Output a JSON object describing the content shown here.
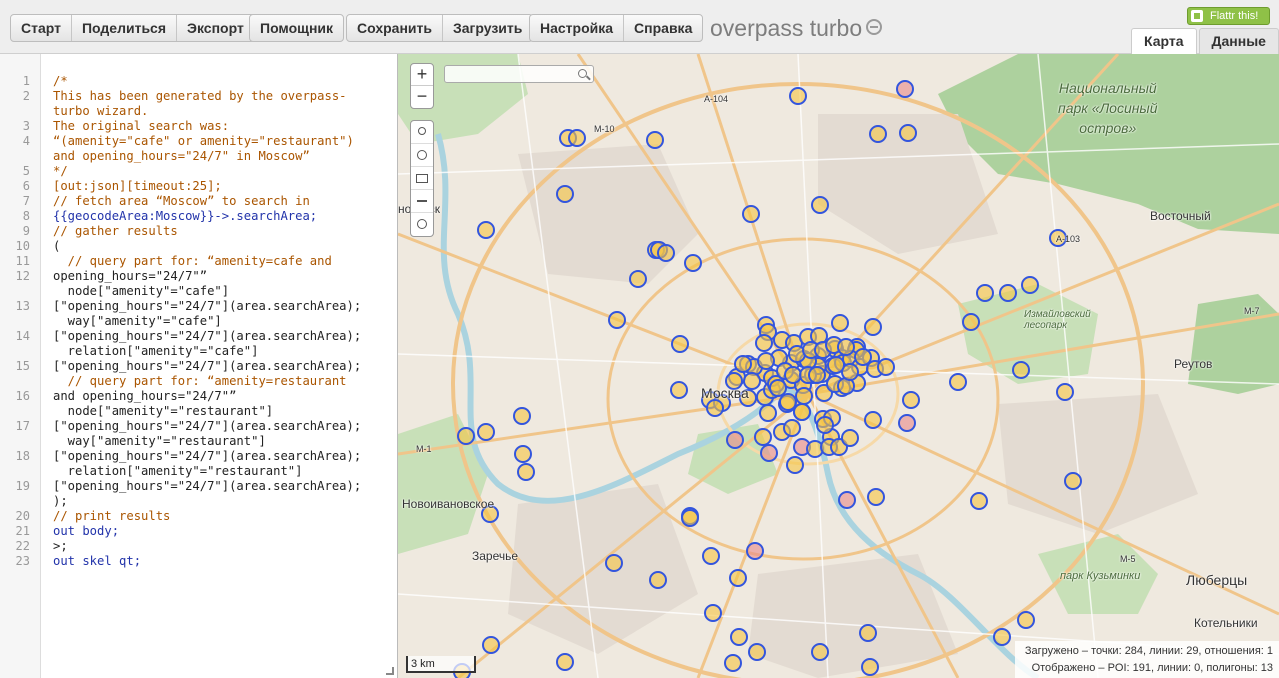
{
  "toolbar": {
    "group1": [
      "Старт",
      "Поделиться",
      "Экспорт"
    ],
    "group2": [
      "Помощник"
    ],
    "group3": [
      "Сохранить",
      "Загрузить"
    ],
    "group4": [
      "Настройка",
      "Справка"
    ],
    "app_title": "overpass turbo",
    "flattr_label": "Flattr this!"
  },
  "tabs": [
    {
      "label": "Карта",
      "active": true
    },
    {
      "label": "Данные",
      "active": false
    }
  ],
  "editor": {
    "line_numbers": [
      "1",
      "2",
      "3",
      "4",
      "5",
      "6",
      "7",
      "8",
      "9",
      "10",
      "11",
      "12",
      "13",
      "14",
      "15",
      "16",
      "17",
      "18",
      "19",
      "20",
      "21",
      "22",
      "23"
    ],
    "lines": [
      "/*",
      "This has been generated by the overpass-",
      "turbo wizard.",
      "The original search was:",
      "“(amenity=\"cafe\" or amenity=\"restaurant\")",
      "and opening_hours=\"24/7\" in Moscow”",
      "*/",
      "[out:json][timeout:25];",
      "// fetch area “Moscow” to search in",
      "{{geocodeArea:Moscow}}->.searchArea;",
      "// gather results",
      "(",
      "  // query part for: “amenity=cafe and",
      "opening_hours=\"24/7\"”",
      "  node[\"amenity\"=\"cafe\"]",
      "[\"opening_hours\"=\"24/7\"](area.searchArea);",
      "  way[\"amenity\"=\"cafe\"]",
      "[\"opening_hours\"=\"24/7\"](area.searchArea);",
      "  relation[\"amenity\"=\"cafe\"]",
      "[\"opening_hours\"=\"24/7\"](area.searchArea);",
      "  // query part for: “amenity=restaurant",
      "and opening_hours=\"24/7\"”",
      "  node[\"amenity\"=\"restaurant\"]",
      "[\"opening_hours\"=\"24/7\"](area.searchArea);",
      "  way[\"amenity\"=\"restaurant\"]",
      "[\"opening_hours\"=\"24/7\"](area.searchArea);",
      "  relation[\"amenity\"=\"restaurant\"]",
      "[\"opening_hours\"=\"24/7\"](area.searchArea);",
      ");",
      "// print results",
      "out body;",
      ">;",
      "out skel qt;"
    ]
  },
  "map": {
    "zoom_in": "+",
    "zoom_out": "−",
    "scale_label": "3 km",
    "status_loaded": "Загружено – точки: 284, линии: 29, отношения: 1",
    "status_shown": "Отображено – POI: 191, линии: 0, полигоны: 13",
    "labels": {
      "moscow": "Москва",
      "park_losiny": "Национальный\nпарк «Лосиный\nостров»",
      "vostochny": "Восточный",
      "reutov": "Реутов",
      "izmaylovsky": "Измайловский\nлесопарк",
      "novoivanovskoe": "Новоивановское",
      "zarechye": "Заречье",
      "park_kuzminki": "парк Кузьминки",
      "lyubertsy": "Люберцы",
      "kotelniki": "Котельники",
      "krasnogorsk": "ногорск",
      "a104": "A-104",
      "a103": "A-103",
      "m10": "M-10",
      "m7": "M-7",
      "m5": "M-5",
      "m1": "M-1"
    },
    "colors": {
      "marker_stroke": "#3355dd",
      "marker_fill": "#f5c542",
      "marker_red": "#e88a8a",
      "forest": "#add19e"
    }
  }
}
